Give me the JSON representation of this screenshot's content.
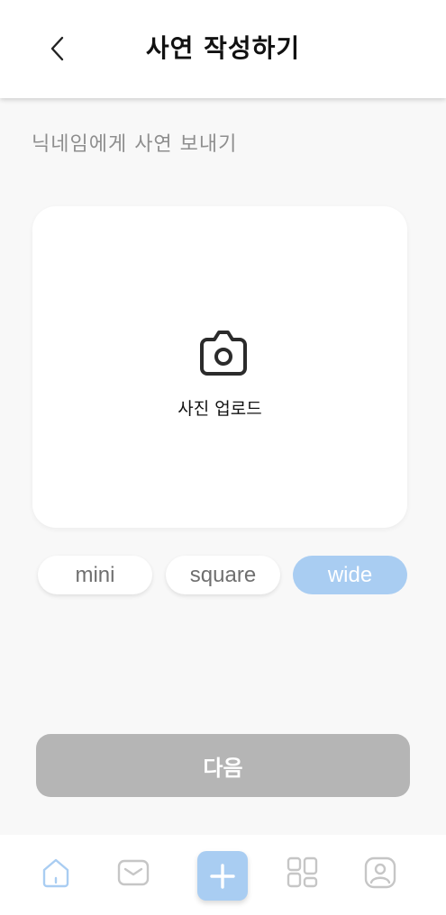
{
  "header": {
    "title": "사연 작성하기",
    "back_icon": "chevron-left-icon"
  },
  "subtitle": "닉네임에게 사연 보내기",
  "upload": {
    "icon": "camera-icon",
    "label": "사진 업로드"
  },
  "size_options": [
    {
      "label": "mini",
      "selected": false
    },
    {
      "label": "square",
      "selected": false
    },
    {
      "label": "wide",
      "selected": true
    }
  ],
  "next_button": {
    "label": "다음",
    "enabled": false
  },
  "tabbar": {
    "items": [
      {
        "icon": "home-icon",
        "active": true
      },
      {
        "icon": "mail-icon",
        "active": false
      },
      {
        "icon": "plus-icon",
        "active": false
      },
      {
        "icon": "grid-icon",
        "active": false
      },
      {
        "icon": "profile-icon",
        "active": false
      }
    ]
  },
  "colors": {
    "accent": "#a9cdf2",
    "disabled_button": "#b5b5b5",
    "background": "#f8f8f8",
    "inactive_icon": "#c6c6c6"
  }
}
